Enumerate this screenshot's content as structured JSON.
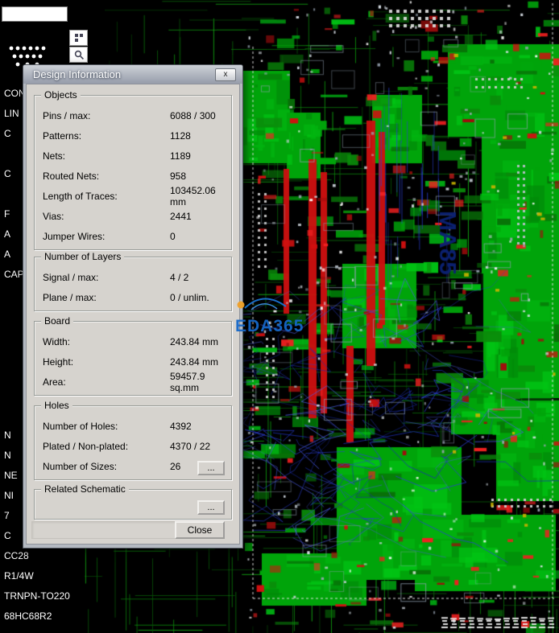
{
  "app": {
    "topbar": {
      "search_value": ""
    }
  },
  "dialog": {
    "title": "Design Information",
    "close_x": "x",
    "groups": {
      "objects": {
        "label": "Objects",
        "rows": [
          {
            "label": "Pins / max:",
            "value": "6088 / 300"
          },
          {
            "label": "Patterns:",
            "value": "1128"
          },
          {
            "label": "Nets:",
            "value": "1189"
          },
          {
            "label": "Routed Nets:",
            "value": "958"
          },
          {
            "label": "Length of Traces:",
            "value": "103452.06 mm"
          },
          {
            "label": "Vias:",
            "value": "2441"
          },
          {
            "label": "Jumper Wires:",
            "value": "0"
          }
        ]
      },
      "layers": {
        "label": "Number of Layers",
        "rows": [
          {
            "label": "Signal / max:",
            "value": "4 / 2"
          },
          {
            "label": "Plane / max:",
            "value": "0 / unlim."
          }
        ]
      },
      "board": {
        "label": "Board",
        "rows": [
          {
            "label": "Width:",
            "value": "243.84 mm"
          },
          {
            "label": "Height:",
            "value": "243.84 mm"
          },
          {
            "label": "Area:",
            "value": "59457.9 sq.mm"
          }
        ]
      },
      "holes": {
        "label": "Holes",
        "rows": [
          {
            "label": "Number of Holes:",
            "value": "4392"
          },
          {
            "label": "Plated / Non-plated:",
            "value": "4370 / 22"
          },
          {
            "label": "Number of Sizes:",
            "value": "26"
          }
        ],
        "more_button": "..."
      },
      "schematic": {
        "label": "Related Schematic",
        "more_button": "..."
      }
    },
    "close_button": "Close"
  },
  "sidebar": {
    "items": [
      "CON",
      "LIN",
      "C",
      "",
      "C",
      "",
      "F",
      "A",
      "A",
      "CAP",
      "",
      "",
      "",
      "",
      "",
      "",
      "",
      "N",
      "N",
      "NE",
      "NI",
      "7",
      "C",
      "CC28",
      "R1/4W",
      "TRNPN-TO220",
      "68HC68R2"
    ]
  },
  "pcb": {
    "silkscreen_text": "MA85"
  },
  "watermark": {
    "text": "EDA365"
  },
  "colors": {
    "dialog_bg": "#d6d3ce",
    "pcb_green": "#00a40a",
    "pcb_red": "#cf1010",
    "pcb_blue": "#2b3fd4",
    "silkscreen_navy": "#0c2274",
    "watermark_blue": "#1668c8"
  }
}
